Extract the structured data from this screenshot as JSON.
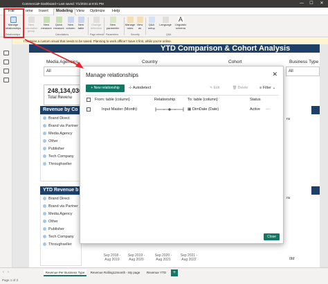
{
  "window": {
    "title": "Commercial• Dashboard • Last saved: 7/1/2024 at 9:01 PM",
    "minimize": "—",
    "maximize": "☐",
    "close": "✕"
  },
  "menu": {
    "file": "File",
    "home": "ome",
    "insert": "Insert",
    "modeling": "Modeling",
    "view": "View",
    "optimize": "Optimize",
    "help": "Help"
  },
  "ribbon": {
    "manage_relationships": "Manage relationships",
    "new_calculation_group": "New calculation group",
    "new_measure": "New measure",
    "quick_measure": "Quick measure",
    "new_column": "New column",
    "new_table": "New table",
    "change_detection": "Change detection",
    "new_parameter": "New parameter",
    "manage_roles": "Manage roles",
    "view_as": "View as",
    "qa_setup": "Q&A setup",
    "language": "Language",
    "linguistic_schema": "Linguistic schema",
    "groups": {
      "relationships": "Relationships",
      "calculations": "Calculations",
      "page_refresh": "Page refresh",
      "parameters": "Parameters",
      "security": "Security",
      "qa": "Q&A"
    }
  },
  "infobar": {
    "text": "t contains a custom visual that needs to be saved. Planning to work offline? Save it first, while you're online."
  },
  "report": {
    "banner": "YTD Comparison & Cohort Analysis",
    "slicers": [
      {
        "label": "Media Agencies",
        "value": "All"
      },
      {
        "label": "Country",
        "value": ""
      },
      {
        "label": "Cohort",
        "value": ""
      },
      {
        "label": "Business Type",
        "value": "All"
      }
    ],
    "kpi": {
      "value": "248,134,036",
      "label": "Total Revenu"
    },
    "panel1_title": "Revenue by Co",
    "panel2_title": "YTD Revenue b",
    "legend": [
      "Brand Direct",
      "Brand via Partner",
      "Media Agency",
      "Other",
      "Publisher",
      "Tech Company",
      "Throughseller"
    ],
    "right_labels": {
      "r1": "ra",
      "r2": "ra",
      "zero": "0M"
    },
    "axis": [
      "Sep 2018 - Aug 2019",
      "Sep 2019 - Aug 2020",
      "Sep 2020 - Aug 2021",
      "Sep 2021 - Aug 2022"
    ]
  },
  "modal": {
    "title": "Manage relationships",
    "close": "✕",
    "new_relationship": "+ New relationship",
    "autodetect": "Autodetect",
    "edit": "Edit",
    "delete": "Delete",
    "filter": "Filter",
    "columns": {
      "from": "From: table (column)",
      "relationship": "Relationship",
      "to": "To: table (column)",
      "status": "Status"
    },
    "rows": [
      {
        "from": "Input Master (Month)",
        "to": "DimDate (Date)",
        "status": "Active",
        "more": "···"
      }
    ],
    "close_button": "Close"
  },
  "pages": [
    "Revenue Per Business Type",
    "Revenue Rolling12month - My page",
    "Revenue YTD"
  ],
  "add_page": "+",
  "status": {
    "page": "Page 1 of 3"
  }
}
